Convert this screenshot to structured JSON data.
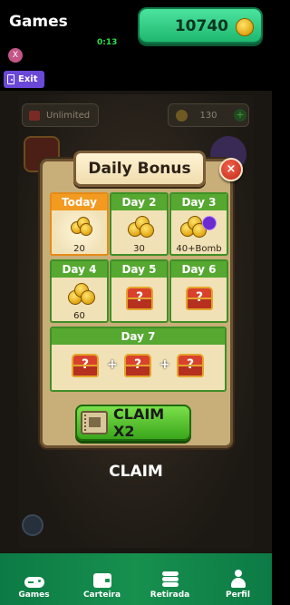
{
  "header": {
    "title": "Games",
    "coin_balance": "10740",
    "timer": "0:13",
    "close_label": "X",
    "exit_label": "Exit"
  },
  "background": {
    "unlimited_label": "Unlimited",
    "coins_value": "130"
  },
  "dialog": {
    "title": "Daily Bonus",
    "close_label": "×",
    "days": [
      {
        "label": "Today",
        "reward": "coins",
        "amount": "20"
      },
      {
        "label": "Day 2",
        "reward": "coins",
        "amount": "30"
      },
      {
        "label": "Day 3",
        "reward": "coins+bomb",
        "amount": "40+Bomb"
      },
      {
        "label": "Day 4",
        "reward": "coins",
        "amount": "60"
      },
      {
        "label": "Day 5",
        "reward": "chest",
        "amount": ""
      },
      {
        "label": "Day 6",
        "reward": "chest",
        "amount": ""
      },
      {
        "label": "Day 7",
        "reward": "3 chests",
        "amount": ""
      }
    ],
    "chest_mark": "?",
    "plus": "+",
    "claim_x2_label": "CLAIM X2"
  },
  "claim_label": "CLAIM",
  "nav": {
    "items": [
      {
        "label": "Games",
        "icon": "gamepad-icon"
      },
      {
        "label": "Carteira",
        "icon": "wallet-icon"
      },
      {
        "label": "Retirada",
        "icon": "coin-stack-icon"
      },
      {
        "label": "Perfil",
        "icon": "user-icon"
      }
    ]
  },
  "colors": {
    "nav_green": "#17904e",
    "balance_green": "#2ecf85",
    "day_header_green": "#56a831",
    "today_orange": "#f39a20",
    "exit_purple": "#6a48d8"
  }
}
